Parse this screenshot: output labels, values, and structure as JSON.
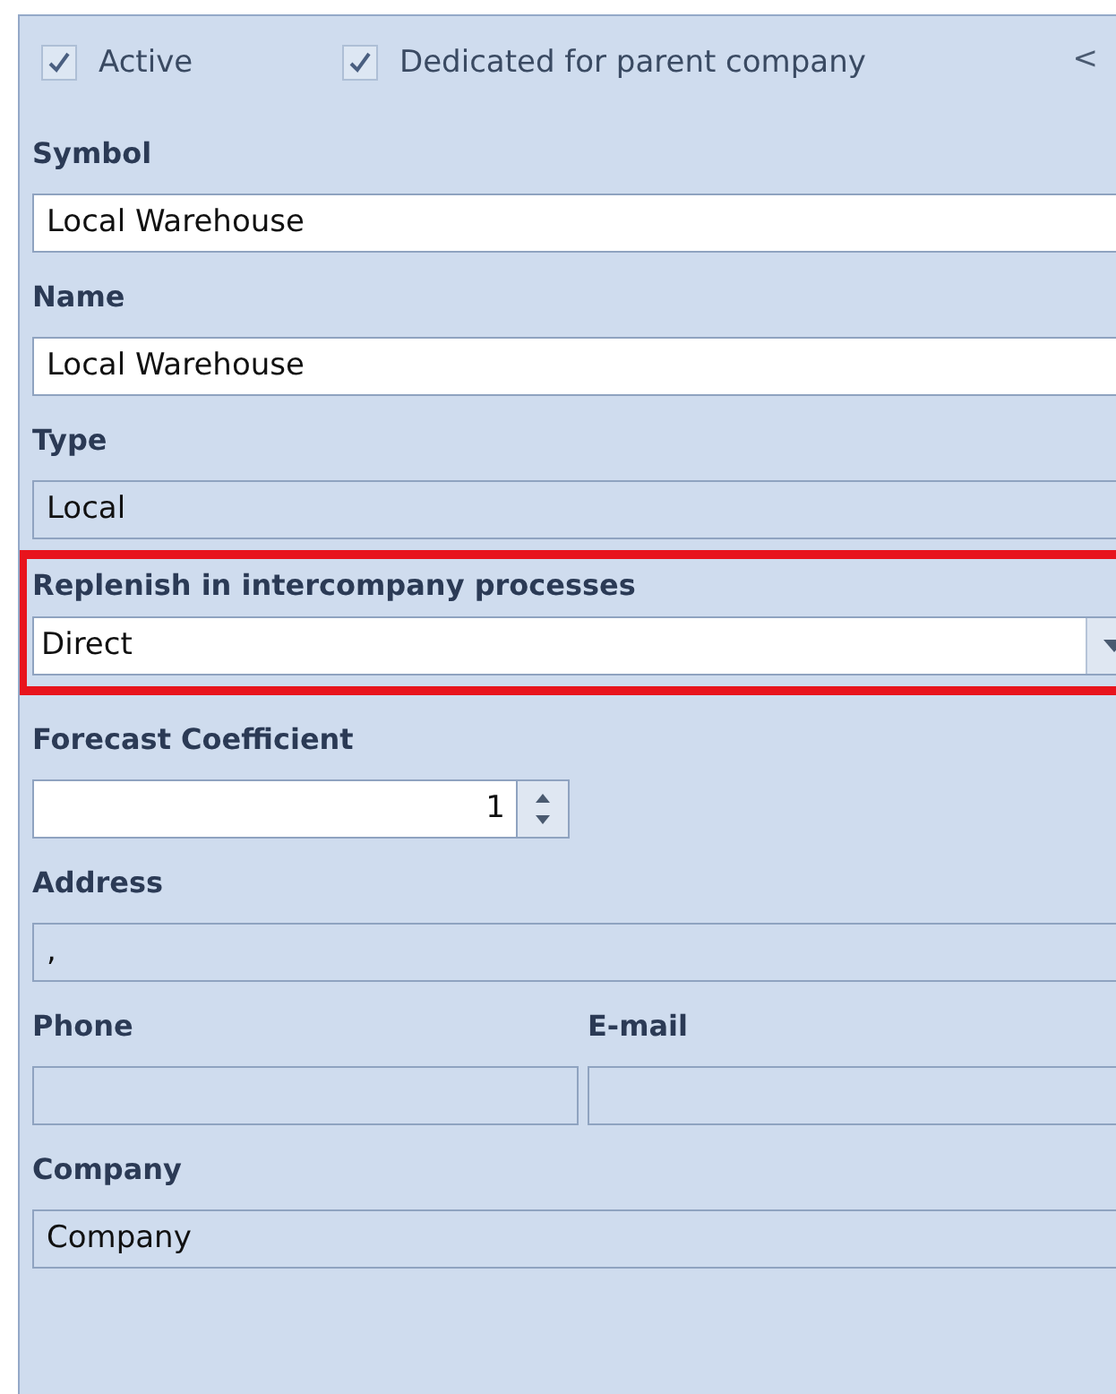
{
  "checkboxes": [
    {
      "label": "Active",
      "checked": true
    },
    {
      "label": "Dedicated for parent company",
      "checked": true
    }
  ],
  "collapse": "<",
  "fields": [
    {
      "kind": "text",
      "label": "Symbol",
      "value": "Local Warehouse",
      "disabled": false,
      "highlighted": false
    },
    {
      "kind": "text",
      "label": "Name",
      "value": "Local Warehouse",
      "disabled": false,
      "highlighted": false
    },
    {
      "kind": "text",
      "label": "Type",
      "value": "Local",
      "disabled": true,
      "highlighted": false
    },
    {
      "kind": "dropdown",
      "label": "Replenish in intercompany processes",
      "value": "Direct",
      "disabled": false,
      "highlighted": true
    },
    {
      "kind": "spinner",
      "label": "Forecast Coefficient",
      "value": "1",
      "disabled": false,
      "highlighted": false
    },
    {
      "kind": "text",
      "label": "Address",
      "value": ",",
      "disabled": true,
      "highlighted": false
    },
    {
      "kind": "pair",
      "items": [
        {
          "label": "Phone",
          "disabled": true
        },
        {
          "label": "E-mail",
          "disabled": true
        }
      ]
    },
    {
      "kind": "text",
      "label": "Company",
      "value": "Company",
      "disabled": true,
      "highlighted": false
    }
  ]
}
